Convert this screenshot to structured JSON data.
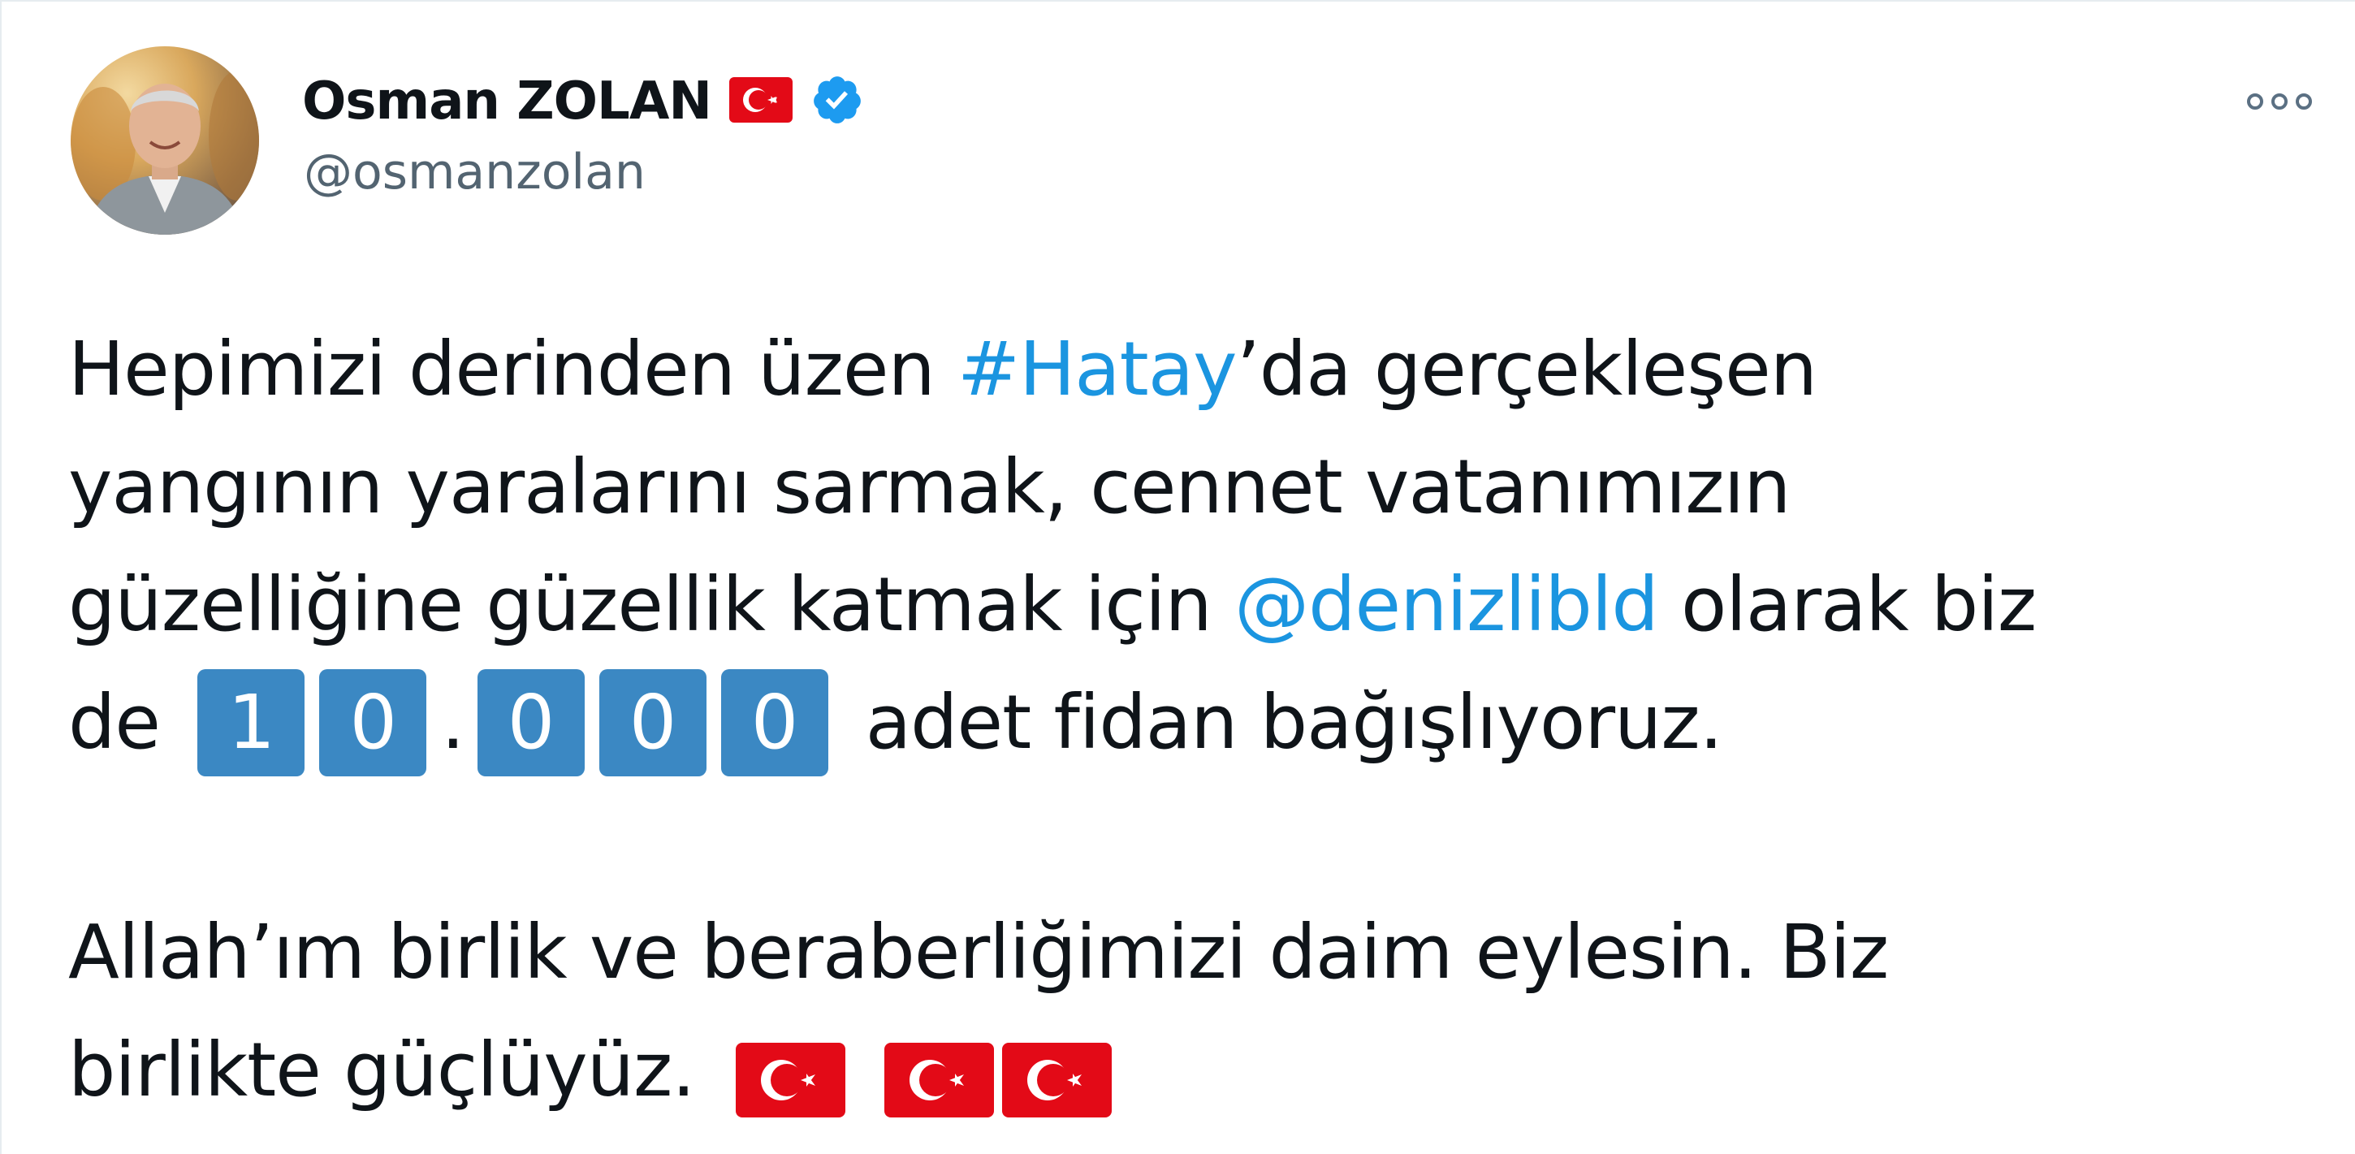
{
  "user": {
    "display_name": "Osman ZOLAN",
    "handle": "@osmanzolan",
    "name_flag_icon": "turkey-flag-icon",
    "verified_icon": "verified-badge-icon"
  },
  "menu": {
    "icon": "more-options-icon"
  },
  "tweet": {
    "l1_a": "Hepimizi derinden üzen ",
    "l1_hashtag": "#Hatay",
    "l1_b": "’da gerçekleşen",
    "l2": "yangının yaralarını sarmak, cennet vatanımızın",
    "l3_a": "güzelliğine güzellik katmak için ",
    "l3_mention": "@denizlibld",
    "l3_b": " olarak biz",
    "l4_a": "de ",
    "digits": [
      "1",
      "0",
      "0",
      "0",
      "0"
    ],
    "digit_separator": ".",
    "l4_b": " adet fidan bağışlıyoruz.",
    "l5": "Allah’ım birlik ve beraberliğimizi daim eylesin. Biz",
    "l6": "birlikte güçlüyüz. "
  },
  "colors": {
    "link": "#1b95e0",
    "flag_red": "#e30a17",
    "verified": "#1d9bf0",
    "keycap": "#3b88c3",
    "handle": "#536471"
  }
}
